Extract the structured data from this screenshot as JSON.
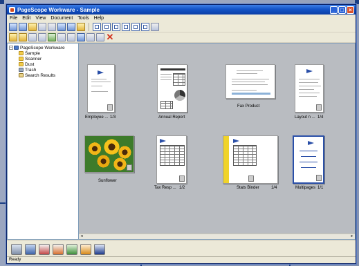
{
  "window": {
    "title": "PageScope Workware - Sample"
  },
  "menu": [
    "File",
    "Edit",
    "View",
    "Document",
    "Tools",
    "Help"
  ],
  "tree": [
    {
      "label": "PageScope Workware",
      "level": 0,
      "icon": "root-icon"
    },
    {
      "label": "Sample",
      "level": 1,
      "icon": "folder-icon"
    },
    {
      "label": "Scanner",
      "level": 1,
      "icon": "folder-icon"
    },
    {
      "label": "Dust",
      "level": 1,
      "icon": "folder-icon"
    },
    {
      "label": "Trash",
      "level": 1,
      "icon": "trash-icon"
    },
    {
      "label": "Search Results",
      "level": 1,
      "icon": "search-icon"
    }
  ],
  "documents": [
    {
      "label": "Employee ...",
      "pages": "1/3"
    },
    {
      "label": "Annual Report",
      "pages": ""
    },
    {
      "label": "Fax Product",
      "pages": ""
    },
    {
      "label": "Layout n ...",
      "pages": "1/4"
    },
    {
      "label": "Sunflower",
      "pages": ""
    },
    {
      "label": "Tax Resp ...",
      "pages": "1/2"
    },
    {
      "label": "Stats Binder",
      "pages": "1/4"
    },
    {
      "label": "Multipages",
      "pages": "1/1"
    }
  ],
  "status": {
    "text": "Ready"
  },
  "colors": {
    "title_bar": "#1454c8",
    "workspace": "#b9bcc1",
    "accent": "#1b3f85"
  }
}
